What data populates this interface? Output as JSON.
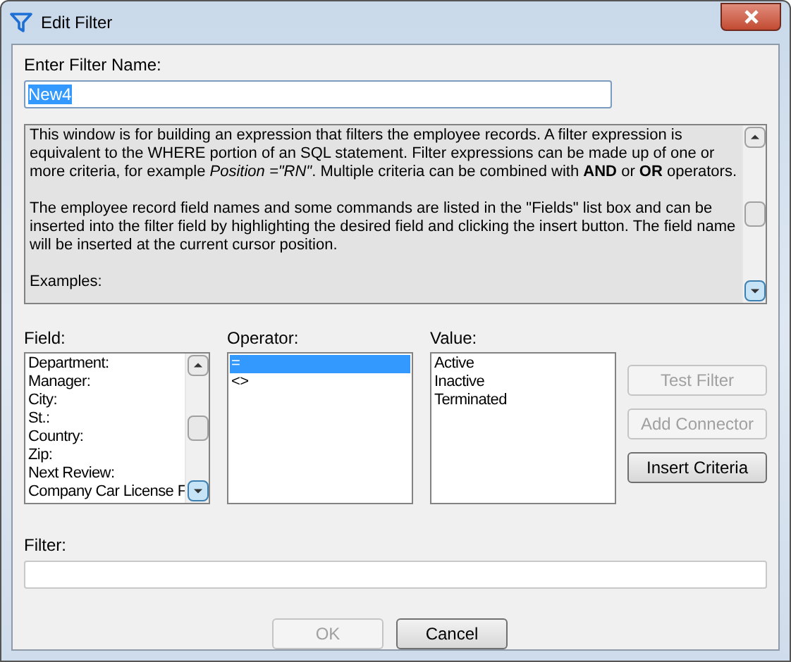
{
  "window": {
    "title": "Edit Filter"
  },
  "filter_name": {
    "label": "Enter Filter Name:",
    "value": "New4",
    "highlighted": true
  },
  "description": [
    "This window is for building an expression that filters the employee records. A filter expression is equivalent to the WHERE portion of an SQL statement. Filter expressions can be made up of one or more criteria, for example *Position =\"RN\"*. Multiple criteria can be combined with **AND** or **OR** operators.",
    "The employee record field names and some commands are listed in the \"Fields\" list box and can be inserted into the filter field by highlighting the desired field and clicking the insert button. The field name will be inserted at the current cursor position.",
    "Examples:"
  ],
  "lists": [
    {
      "label": "Field:",
      "scrollbar": true,
      "items": [
        {
          "text": "Department:",
          "selected": false
        },
        {
          "text": "Manager:",
          "selected": false
        },
        {
          "text": "City:",
          "selected": false
        },
        {
          "text": "St.:",
          "selected": false
        },
        {
          "text": "Country:",
          "selected": false
        },
        {
          "text": "Zip:",
          "selected": false
        },
        {
          "text": "Next Review:",
          "selected": false
        },
        {
          "text": "Company Car License F",
          "selected": false
        }
      ]
    },
    {
      "label": "Operator:",
      "scrollbar": false,
      "items": [
        {
          "text": "=",
          "selected": true
        },
        {
          "text": "<>",
          "selected": false
        }
      ]
    },
    {
      "label": "Value:",
      "scrollbar": false,
      "items": [
        {
          "text": "Active",
          "selected": false
        },
        {
          "text": "Inactive",
          "selected": false
        },
        {
          "text": "Terminated",
          "selected": false
        }
      ]
    }
  ],
  "side_buttons": [
    {
      "label": "Test Filter",
      "disabled": true
    },
    {
      "label": "Add Connector",
      "disabled": true
    },
    {
      "label": "Insert Criteria",
      "disabled": false
    }
  ],
  "filter": {
    "label": "Filter:"
  },
  "buttons": [
    {
      "label": "OK",
      "disabled": true
    },
    {
      "label": "Cancel",
      "disabled": false
    }
  ]
}
